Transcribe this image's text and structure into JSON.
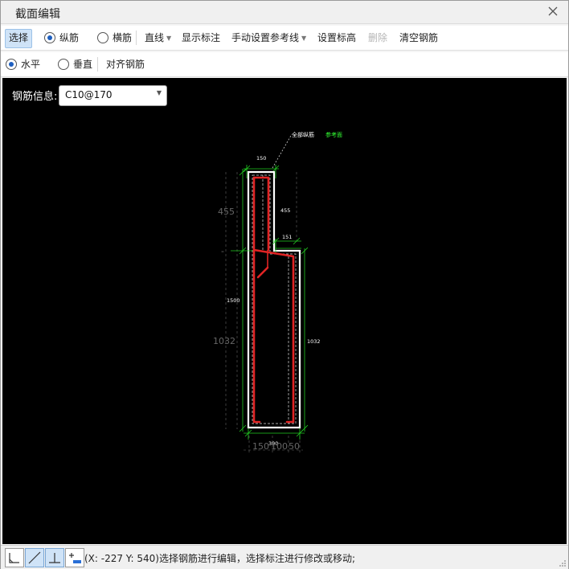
{
  "window": {
    "title": "截面编辑"
  },
  "toolbar1": {
    "select": "选择",
    "longitudinal": "纵筋",
    "transverse": "横筋",
    "line": "直线",
    "show_dim": "显示标注",
    "manual_ref": "手动设置参考线",
    "set_elev": "设置标高",
    "delete": "删除",
    "clear": "清空钢筋"
  },
  "toolbar2": {
    "horizontal": "水平",
    "vertical": "垂直",
    "align": "对齐钢筋"
  },
  "canvas": {
    "rebar_info_label": "钢筋信息:",
    "rebar_info_value": "C10@170",
    "labels": {
      "all_long": "全部纵筋",
      "ref_line": "参考面",
      "top_w": "150",
      "left_h1": "455",
      "mid_h1": "455",
      "notch_w": "151",
      "left_pre": "-",
      "left_h2": "1500",
      "total_left": "1032",
      "right_h": "1032",
      "bot_w": "300",
      "bot_150": "150",
      "bot_100": "100",
      "bot_50": "50"
    }
  },
  "status": {
    "text": "(X: -227 Y: 540)选择钢筋进行编辑，选择标注进行修改或移动;"
  },
  "colors": {
    "canvas_bg": "#000000",
    "section_outline": "#ffffff",
    "rebar": "#e02424",
    "dimension": "#22cc22",
    "ref_text": "#33ff33"
  }
}
